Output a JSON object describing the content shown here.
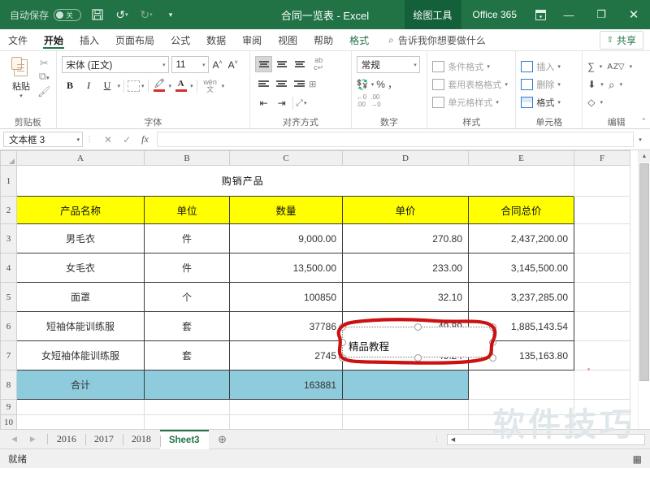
{
  "titlebar": {
    "autosave_label": "自动保存",
    "autosave_state": "关",
    "save_icon": "save-icon",
    "undo_icon": "undo-icon",
    "redo_icon": "redo-icon",
    "customize_icon": "customize-quick-access-icon",
    "document_title": "合同一览表  -  Excel",
    "context_tab": "绘图工具",
    "account": "Office 365",
    "ribbon_display_icon": "ribbon-display-options-icon",
    "minimize": "—",
    "maximize": "❐",
    "close": "✕",
    "accent_color": "#217346",
    "context_tab_color": "#14603a"
  },
  "ribbon_tabs": {
    "items": [
      {
        "label": "文件",
        "active": false,
        "context": false
      },
      {
        "label": "开始",
        "active": true,
        "context": false
      },
      {
        "label": "插入",
        "active": false,
        "context": false
      },
      {
        "label": "页面布局",
        "active": false,
        "context": false
      },
      {
        "label": "公式",
        "active": false,
        "context": false
      },
      {
        "label": "数据",
        "active": false,
        "context": false
      },
      {
        "label": "审阅",
        "active": false,
        "context": false
      },
      {
        "label": "视图",
        "active": false,
        "context": false
      },
      {
        "label": "帮助",
        "active": false,
        "context": false
      },
      {
        "label": "格式",
        "active": false,
        "context": true
      }
    ],
    "tell_me": "告诉我你想要做什么",
    "share": "共享"
  },
  "ribbon": {
    "clipboard": {
      "group_name": "剪贴板",
      "paste_label": "粘贴",
      "cut_icon": "scissors-icon",
      "copy_icon": "copy-icon",
      "format_painter_icon": "format-painter-icon"
    },
    "font": {
      "group_name": "字体",
      "font_name": "宋体 (正文)",
      "font_size": "11",
      "grow_font": "A",
      "shrink_font": "A",
      "bold": "B",
      "italic": "I",
      "underline": "U",
      "borders_icon": "borders-icon",
      "fill_color_icon": "fill-color-icon",
      "font_color_icon": "font-color-icon",
      "phonetic_icon": "phonetic-guide-icon",
      "phonetic_label": "wén\n文"
    },
    "alignment": {
      "group_name": "对齐方式",
      "wrap_text_icon": "wrap-text-icon",
      "merge_icon": "merge-cells-icon"
    },
    "number": {
      "group_name": "数字",
      "format": "常规",
      "accounting_icon": "accounting-format-icon",
      "percent": "%",
      "comma": "，",
      "increase_decimal_icon": "increase-decimal-icon",
      "decrease_decimal_icon": "decrease-decimal-icon"
    },
    "styles": {
      "group_name": "样式",
      "items": [
        "条件格式",
        "套用表格格式",
        "单元格样式"
      ]
    },
    "cells": {
      "group_name": "单元格",
      "items": [
        "插入",
        "删除",
        "格式"
      ]
    },
    "editing": {
      "group_name": "编辑",
      "autosum_icon": "autosum-sigma-icon",
      "fill_icon": "fill-down-icon",
      "clear_icon": "clear-eraser-icon",
      "sort_icon": "sort-filter-icon",
      "find_icon": "find-select-magnifier-icon"
    }
  },
  "formula_bar": {
    "name_box": "文本框 3",
    "cancel_icon": "cancel-x-icon",
    "confirm_icon": "confirm-check-icon",
    "function_icon": "insert-function-fx-icon",
    "formula_value": ""
  },
  "grid": {
    "columns": [
      "A",
      "B",
      "C",
      "D",
      "E",
      "F"
    ],
    "rows": [
      "1",
      "2",
      "3",
      "4",
      "5",
      "6",
      "7",
      "8",
      "9",
      "10"
    ],
    "sheet_title": "购销产品",
    "headers": [
      "产品名称",
      "单位",
      "数量",
      "单价",
      "合同总价"
    ],
    "header_fill": "#ffff00",
    "total_fill": "#8ecbdd",
    "data": [
      {
        "name": "男毛衣",
        "unit": "件",
        "qty": "9,000.00",
        "price": "270.80",
        "total": "2,437,200.00"
      },
      {
        "name": "女毛衣",
        "unit": "件",
        "qty": "13,500.00",
        "price": "233.00",
        "total": "3,145,500.00"
      },
      {
        "name": "面罩",
        "unit": "个",
        "qty": "100850",
        "price": "32.10",
        "total": "3,237,285.00"
      },
      {
        "name": "短袖体能训练服",
        "unit": "套",
        "qty": "37786",
        "price": "49.89",
        "total": "1,885,143.54"
      },
      {
        "name": "女短袖体能训练服",
        "unit": "套",
        "qty": "2745",
        "price": "49.24",
        "total": "135,163.80"
      }
    ],
    "total_row": {
      "label": "合计",
      "unit": "",
      "qty": "163881",
      "price": "",
      "total": ""
    }
  },
  "textbox": {
    "text": "精品教程",
    "name": "文本框 3",
    "annotation_color": "#cc1111"
  },
  "watermark": "软件技巧",
  "sheet_tabs": {
    "prev_icon": "previous-sheet-icon",
    "next_icon": "next-sheet-icon",
    "items": [
      {
        "label": "2016",
        "active": false
      },
      {
        "label": "2017",
        "active": false
      },
      {
        "label": "2018",
        "active": false
      },
      {
        "label": "Sheet3",
        "active": true
      }
    ],
    "add_label": "＋"
  },
  "status_bar": {
    "status": "就绪",
    "normal_view_icon": "normal-view-icon"
  }
}
